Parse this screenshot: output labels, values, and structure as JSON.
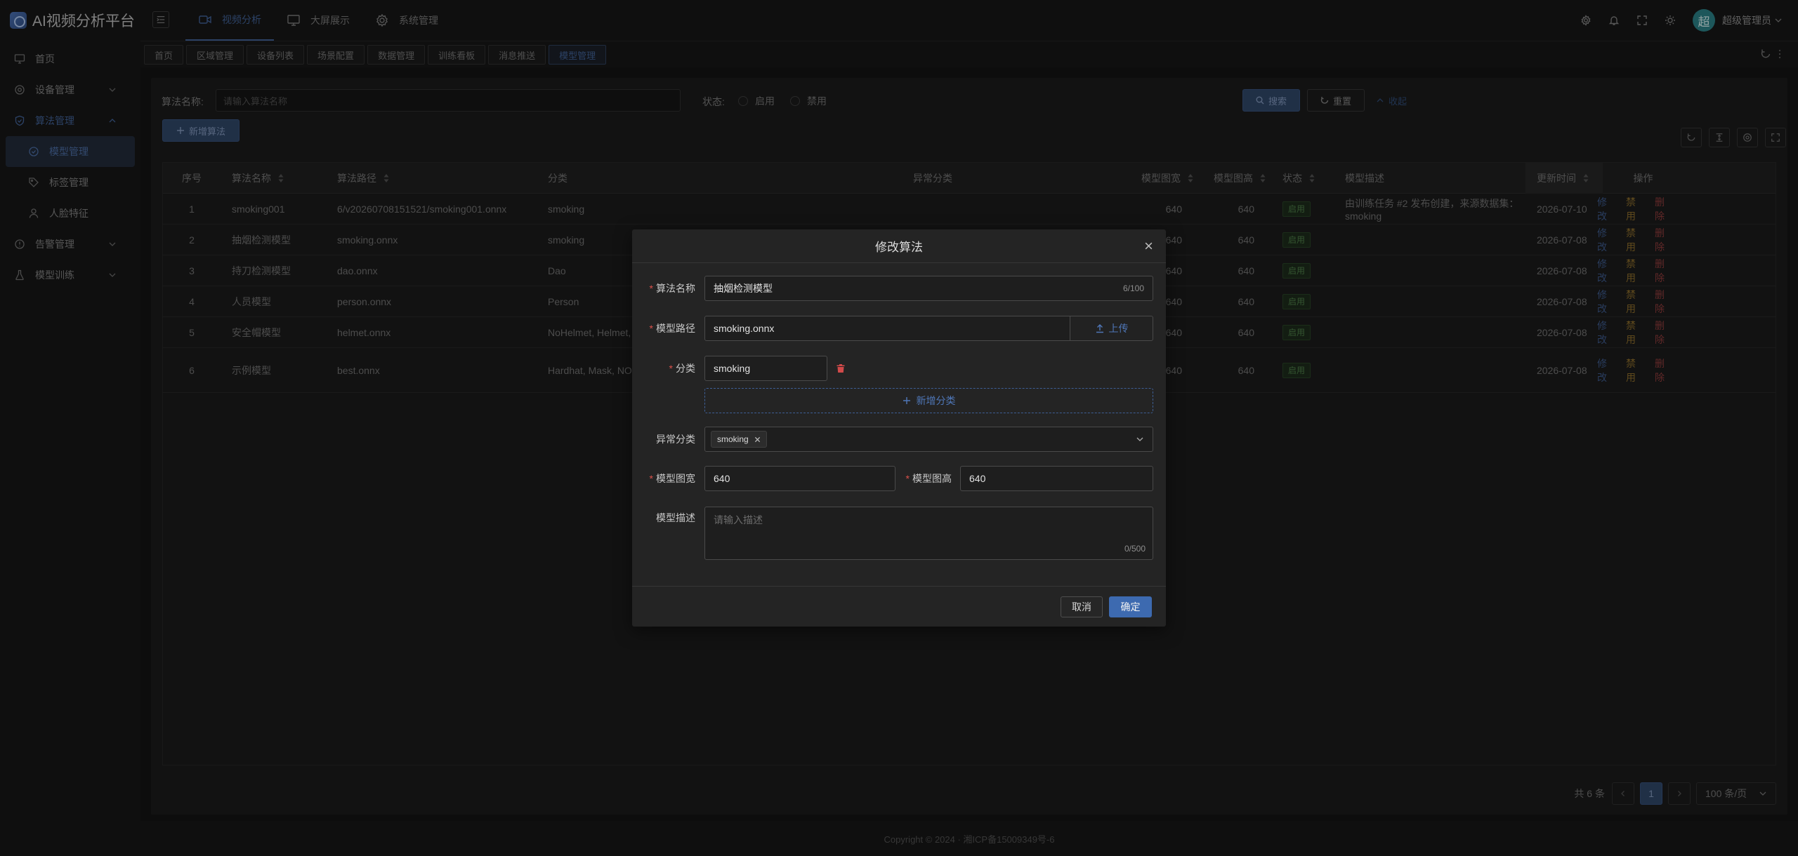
{
  "app": {
    "title": "AI视频分析平台"
  },
  "sidebar": {
    "items": [
      {
        "label": "首页",
        "icon": "monitor-icon"
      },
      {
        "label": "设备管理",
        "icon": "gear-icon"
      },
      {
        "label": "算法管理",
        "icon": "shield-icon",
        "expanded": true
      },
      {
        "label": "模型管理",
        "icon": "cube-icon",
        "active": true
      },
      {
        "label": "标签管理",
        "icon": "tag-icon"
      },
      {
        "label": "人脸特征",
        "icon": "user-icon"
      },
      {
        "label": "告警管理",
        "icon": "alert-icon"
      },
      {
        "label": "模型训练",
        "icon": "flask-icon"
      }
    ]
  },
  "header": {
    "nav": [
      {
        "label": "视频分析",
        "icon": "video-icon",
        "active": true
      },
      {
        "label": "大屏展示",
        "icon": "screen-icon"
      },
      {
        "label": "系统管理",
        "icon": "gear-icon"
      }
    ],
    "icons": [
      "settings-icon",
      "bell-icon",
      "fullscreen-icon",
      "theme-icon"
    ],
    "avatar_text": "超",
    "username": "超级管理员"
  },
  "tabs": [
    "首页",
    "区域管理",
    "设备列表",
    "场景配置",
    "数据管理",
    "训练看板",
    "消息推送",
    "模型管理"
  ],
  "search": {
    "name_label": "算法名称:",
    "name_placeholder": "请输入算法名称",
    "status_label": "状态:",
    "status_options": [
      "启用",
      "禁用"
    ],
    "search_btn": "搜索",
    "reset_btn": "重置",
    "collapse_btn": "收起",
    "add_btn": "新增算法"
  },
  "table": {
    "columns": [
      "序号",
      "算法名称",
      "算法路径",
      "分类",
      "异常分类",
      "模型图宽",
      "模型图高",
      "状态",
      "模型描述",
      "更新时间",
      "操作"
    ],
    "rows": [
      {
        "idx": "1",
        "name": "smoking001",
        "path": "6/v20260708151521/smoking001.onnx",
        "category": "smoking",
        "abnormal": "",
        "width": "640",
        "height": "640",
        "status": "启用",
        "desc": "由训练任务 #2 发布创建，来源数据集：smoking",
        "updated": "2026-07-10"
      },
      {
        "idx": "2",
        "name": "抽烟检测模型",
        "path": "smoking.onnx",
        "category": "smoking",
        "abnormal": "smoking",
        "width": "640",
        "height": "640",
        "status": "启用",
        "desc": "",
        "updated": "2026-07-08"
      },
      {
        "idx": "3",
        "name": "持刀检测模型",
        "path": "dao.onnx",
        "category": "Dao",
        "abnormal": "",
        "width": "640",
        "height": "640",
        "status": "启用",
        "desc": "",
        "updated": "2026-07-08"
      },
      {
        "idx": "4",
        "name": "人员模型",
        "path": "person.onnx",
        "category": "Person",
        "abnormal": "",
        "width": "640",
        "height": "640",
        "status": "启用",
        "desc": "",
        "updated": "2026-07-08"
      },
      {
        "idx": "5",
        "name": "安全帽模型",
        "path": "helmet.onnx",
        "category": "NoHelmet, Helmet, P",
        "abnormal": "",
        "width": "640",
        "height": "640",
        "status": "启用",
        "desc": "",
        "updated": "2026-07-08"
      },
      {
        "idx": "6",
        "name": "示例模型",
        "path": "best.onnx",
        "category": "Hardhat, Mask, NO-H ne, Safety Vest, mach",
        "abnormal": "",
        "width": "640",
        "height": "640",
        "status": "启用",
        "desc": "",
        "updated": "2026-07-08"
      }
    ],
    "ops": [
      "修改",
      "禁用",
      "删除"
    ]
  },
  "pager": {
    "total": "共 6 条",
    "current": "1",
    "size": "100 条/页"
  },
  "footer": {
    "text": "Copyright © 2024 · 湘ICP备15009349号-6"
  },
  "modal": {
    "title": "修改算法",
    "name_label": "算法名称",
    "name_value": "抽烟检测模型",
    "name_count": "6/100",
    "path_label": "模型路径",
    "path_value": "smoking.onnx",
    "upload_btn": "上传",
    "category_label": "分类",
    "category_value": "smoking",
    "add_category": "新增分类",
    "abnormal_label": "异常分类",
    "abnormal_chip": "smoking",
    "width_label": "模型图宽",
    "width_value": "640",
    "height_label": "模型图高",
    "height_value": "640",
    "desc_label": "模型描述",
    "desc_placeholder": "请输入描述",
    "desc_count": "0/500",
    "cancel_btn": "取消",
    "ok_btn": "确定"
  },
  "colors": {
    "primary": "#3d6ab0",
    "danger": "#d9504a",
    "success": "#4b7a45",
    "warning": "#8a6b2a"
  }
}
